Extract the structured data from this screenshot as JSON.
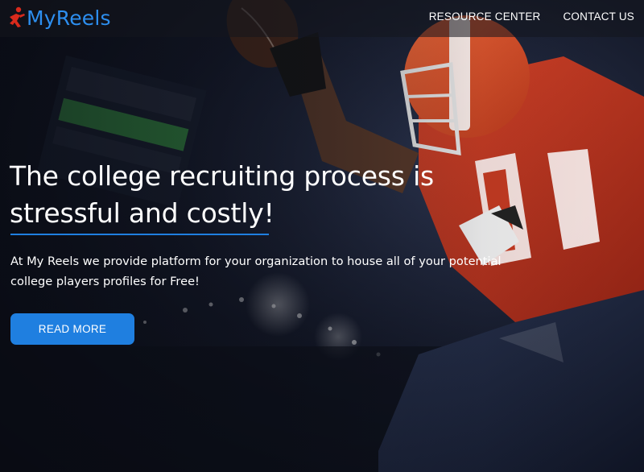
{
  "brand": {
    "name": "MyReels",
    "accent_color": "#2d8ff0",
    "icon": "runner-logo-icon"
  },
  "nav": {
    "items": [
      {
        "label": "RESOURCE CENTER"
      },
      {
        "label": "CONTACT US"
      }
    ]
  },
  "hero": {
    "headline": "The college recruiting process is stressful and costly!",
    "subtext": "At My Reels we provide platform for your organization to house all of your potential college players profiles for Free!",
    "cta_label": "READ MORE",
    "cta_color": "#1f7fe0",
    "background": "football-player-stadium-photo"
  }
}
